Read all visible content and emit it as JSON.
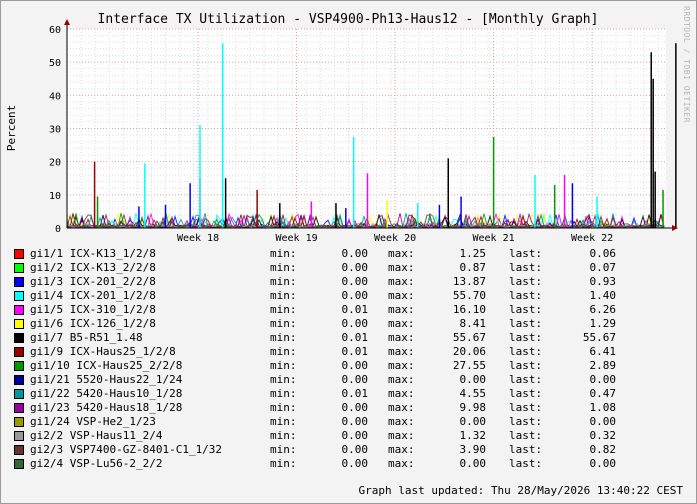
{
  "chart_data": {
    "type": "line",
    "title": "Interface TX Utilization - VSP4900-Ph13-Haus12 - [Monthly Graph]",
    "ylabel": "Percent",
    "xlabel": "",
    "ylim": [
      0,
      60
    ],
    "y_ticks": [
      "0",
      "10",
      "20",
      "30",
      "40",
      "50",
      "60"
    ],
    "x_ticks": [
      "Week 18",
      "Week 19",
      "Week 20",
      "Week 21",
      "Week 22"
    ],
    "grid": true,
    "legend_placement": "bottom",
    "series": [
      {
        "name": "gi1/1 ICX-K13_1/2/8",
        "color": "#ff0000",
        "min": "0.00",
        "max": "1.25",
        "last": "0.06"
      },
      {
        "name": "gi1/2 ICX-K13_2/2/8",
        "color": "#00ff00",
        "min": "0.00",
        "max": "0.87",
        "last": "0.07"
      },
      {
        "name": "gi1/3 ICX-201_2/2/8",
        "color": "#0000ff",
        "min": "0.00",
        "max": "13.87",
        "last": "0.93"
      },
      {
        "name": "gi1/4 ICX-201_1/2/8",
        "color": "#00ffff",
        "min": "0.00",
        "max": "55.70",
        "last": "1.40"
      },
      {
        "name": "gi1/5 ICX-310_1/2/8",
        "color": "#ff00ff",
        "min": "0.01",
        "max": "16.10",
        "last": "6.26"
      },
      {
        "name": "gi1/6 ICX-126_1/2/8",
        "color": "#ffff00",
        "min": "0.00",
        "max": "8.41",
        "last": "1.29"
      },
      {
        "name": "gi1/7 B5-R51_1.48",
        "color": "#000000",
        "min": "0.01",
        "max": "55.67",
        "last": "55.67"
      },
      {
        "name": "gi1/9 ICX-Haus25_1/2/8",
        "color": "#990000",
        "min": "0.01",
        "max": "20.06",
        "last": "6.41"
      },
      {
        "name": "gi1/10 ICX-Haus25_2/2/8",
        "color": "#009900",
        "min": "0.00",
        "max": "27.55",
        "last": "2.89"
      },
      {
        "name": "gi1/21 5520-Haus22_1/24",
        "color": "#000099",
        "min": "0.00",
        "max": "0.00",
        "last": "0.00"
      },
      {
        "name": "gi1/22 5420-Haus10_1/28",
        "color": "#009999",
        "min": "0.01",
        "max": "4.55",
        "last": "0.47"
      },
      {
        "name": "gi1/23 5420-Haus18_1/28",
        "color": "#990099",
        "min": "0.00",
        "max": "9.98",
        "last": "1.08"
      },
      {
        "name": "gi1/24 VSP-He2_1/23",
        "color": "#999900",
        "min": "0.00",
        "max": "0.00",
        "last": "0.00"
      },
      {
        "name": "gi2/2 VSP-Haus11_2/4",
        "color": "#999999",
        "min": "0.00",
        "max": "1.32",
        "last": "0.32"
      },
      {
        "name": "gi2/3 VSP7400-GZ-8401-C1_1/32",
        "color": "#663333",
        "min": "0.00",
        "max": "3.90",
        "last": "0.82"
      },
      {
        "name": "gi2/4 VSP-Lu56-2_2/2",
        "color": "#336633",
        "min": "0.00",
        "max": "0.00",
        "last": "0.00"
      }
    ],
    "peaks": [
      {
        "series": 7,
        "week": 17.45,
        "value": 20
      },
      {
        "series": 8,
        "week": 17.48,
        "value": 9.5
      },
      {
        "series": 2,
        "week": 17.9,
        "value": 6.5
      },
      {
        "series": 3,
        "week": 17.96,
        "value": 19.5
      },
      {
        "series": 2,
        "week": 18.17,
        "value": 7
      },
      {
        "series": 2,
        "week": 18.42,
        "value": 13.5
      },
      {
        "series": 4,
        "week": 18.52,
        "value": 15
      },
      {
        "series": 3,
        "week": 18.52,
        "value": 31
      },
      {
        "series": 3,
        "week": 18.75,
        "value": 55.7
      },
      {
        "series": 6,
        "week": 18.78,
        "value": 15
      },
      {
        "series": 7,
        "week": 19.1,
        "value": 11.5
      },
      {
        "series": 6,
        "week": 19.33,
        "value": 7.5
      },
      {
        "series": 4,
        "week": 19.65,
        "value": 8
      },
      {
        "series": 6,
        "week": 19.9,
        "value": 7.5
      },
      {
        "series": 2,
        "week": 20.0,
        "value": 6
      },
      {
        "series": 3,
        "week": 20.08,
        "value": 27.5
      },
      {
        "series": 4,
        "week": 20.22,
        "value": 16.5
      },
      {
        "series": 5,
        "week": 20.42,
        "value": 8.4
      },
      {
        "series": 3,
        "week": 20.73,
        "value": 7.5
      },
      {
        "series": 2,
        "week": 20.95,
        "value": 7
      },
      {
        "series": 6,
        "week": 21.04,
        "value": 21
      },
      {
        "series": 2,
        "week": 21.17,
        "value": 9.5
      },
      {
        "series": 8,
        "week": 21.5,
        "value": 27.5
      },
      {
        "series": 3,
        "week": 21.92,
        "value": 16
      },
      {
        "series": 8,
        "week": 22.12,
        "value": 13
      },
      {
        "series": 4,
        "week": 22.22,
        "value": 16
      },
      {
        "series": 2,
        "week": 22.3,
        "value": 13.5
      },
      {
        "series": 3,
        "week": 22.55,
        "value": 9.5
      },
      {
        "series": 6,
        "week": 23.1,
        "value": 53
      },
      {
        "series": 6,
        "week": 23.12,
        "value": 45
      },
      {
        "series": 6,
        "week": 23.14,
        "value": 17
      },
      {
        "series": 8,
        "week": 23.22,
        "value": 11.5
      },
      {
        "series": 6,
        "week": 23.35,
        "value": 55.7
      }
    ]
  },
  "footer": {
    "label": "Graph last updated:",
    "value": "Thu 28/May/2026 13:40:22 CEST"
  },
  "legend_labels": {
    "min": "min:",
    "max": "max:",
    "last": "last:"
  },
  "watermark": "RRDTOOL / TOBI OETIKER"
}
